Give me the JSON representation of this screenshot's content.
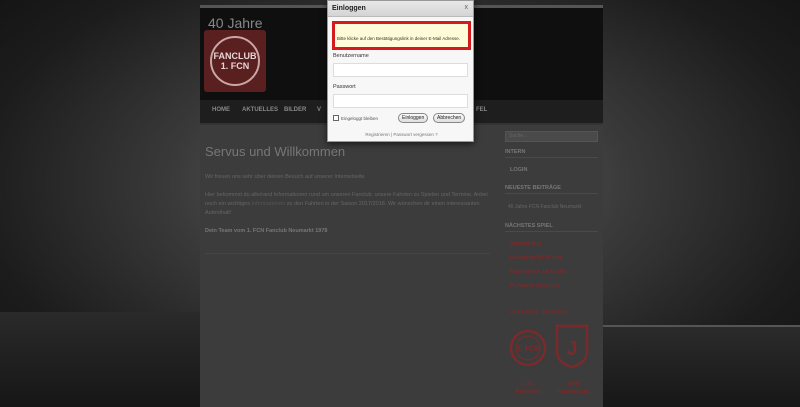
{
  "site": {
    "title": "40 Jahre",
    "logo_text": "FANCLUB 1. FCN"
  },
  "nav": {
    "items": [
      "HOME",
      "AKTUELLES",
      "BILDER",
      "V",
      "FEL"
    ]
  },
  "main": {
    "title": "Servus und Willkommen",
    "paragraph1": "Wir freuen uns sehr über deinen Besuch auf unserer Internetseite",
    "paragraph2_before": "Hier bekommst du alle/rand Informationen rund um unseren Fanclub, unsere Fahrten zu Spielen und Termine. Anbei noch ein wichtiges",
    "paragraph2_link": "Informationen",
    "paragraph2_after": "zu den Fahrten in der Saison 2017/2018. Wir wünschen dir einen interessanten Aufenthalt!",
    "signature": "Dein Team vom 1. FCN Fanclub Neumarkt 1978"
  },
  "sidebar": {
    "search_placeholder": "Suche...",
    "intern_heading": "INTERN",
    "login_item": "LOGIN",
    "recent_heading": "NEUESTE BEITRÄGE",
    "recent_link": "40 Jahre FCN Fanclub Neumarkt",
    "next_match_heading": "NÄCHSTES SPIEL",
    "departures": [
      "Abfahrt Bus",
      "Neumarkt 18:30 Uhr",
      "Pavelsbach 18:45 Uhr",
      "Pyrbaum 18:55 Uhr"
    ],
    "match_date": "23.01.2018 - 20:30 Uhr",
    "team_home_logo": "1. FCN",
    "team_away_logo": "J",
    "team_home": "1. FC Nürnberg",
    "team_away": "Jahn Regensburg"
  },
  "modal": {
    "title": "Einloggen",
    "close_label": "x",
    "notice": "Bitte klicke auf den Bestätigungslink in deiner E-Mail Adresse.",
    "username_label": "Benutzername",
    "password_label": "Passwort",
    "remember_label": "Eingeloggt bleiben",
    "login_button": "Einloggen",
    "cancel_button": "Abbrechen",
    "register_link": "Registrieren",
    "separator": " | ",
    "forgot_link": "Passwort vergessen ?"
  },
  "colors": {
    "accent_red": "#d41a1a",
    "notice_bg": "#fdfbd8",
    "team_red": "#7a2a2a"
  }
}
